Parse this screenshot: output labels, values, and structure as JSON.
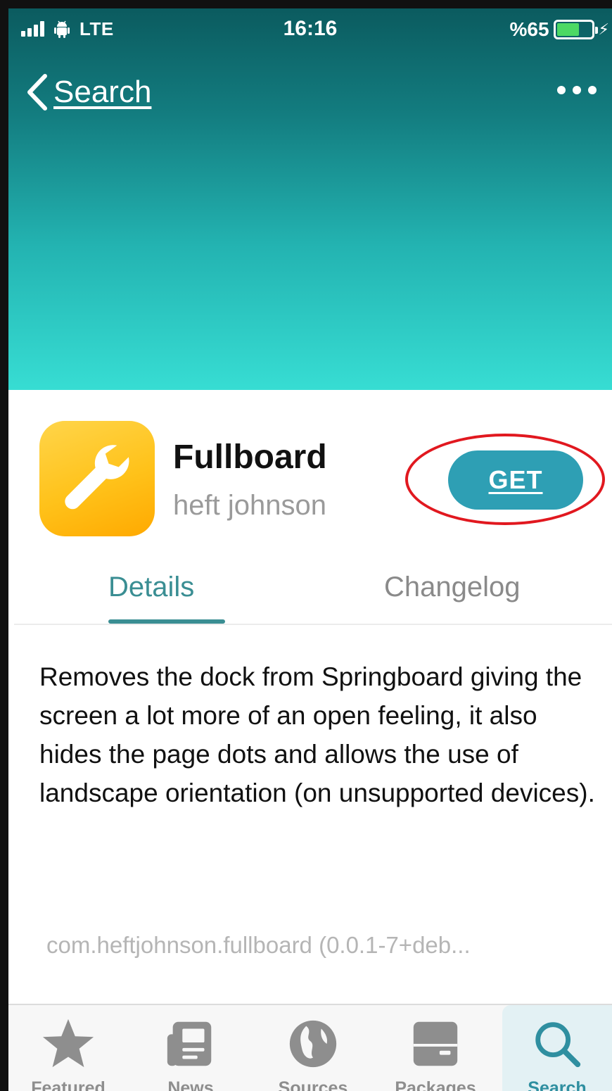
{
  "status_bar": {
    "carrier": "LTE",
    "time": "16:16",
    "battery_percent": "%65",
    "battery_level": 0.65
  },
  "nav": {
    "back_label": "Search",
    "more_icon": "ellipsis-icon"
  },
  "package": {
    "name": "Fullboard",
    "author": "heft johnson",
    "icon": "wrench-icon",
    "get_label": "GET",
    "description": "Removes the dock from Springboard giving the screen a lot more of an open feeling, it also hides the page dots and allows the use of landscape orientation (on unsupported devices).",
    "identifier": "com.heftjohnson.fullboard (0.0.1-7+deb..."
  },
  "tabs": {
    "details": "Details",
    "changelog": "Changelog",
    "active": "details"
  },
  "tab_bar": {
    "items": [
      {
        "label": "Featured",
        "icon": "star-icon"
      },
      {
        "label": "News",
        "icon": "newspaper-icon"
      },
      {
        "label": "Sources",
        "icon": "globe-icon"
      },
      {
        "label": "Packages",
        "icon": "package-icon"
      },
      {
        "label": "Search",
        "icon": "search-icon"
      }
    ],
    "active": "Search"
  },
  "colors": {
    "accent": "#2e9fb4",
    "tab_active": "#3a8e93",
    "highlight_ring": "#e1181f",
    "header_top": "#0b5b5f",
    "header_bottom": "#37ddd3"
  }
}
